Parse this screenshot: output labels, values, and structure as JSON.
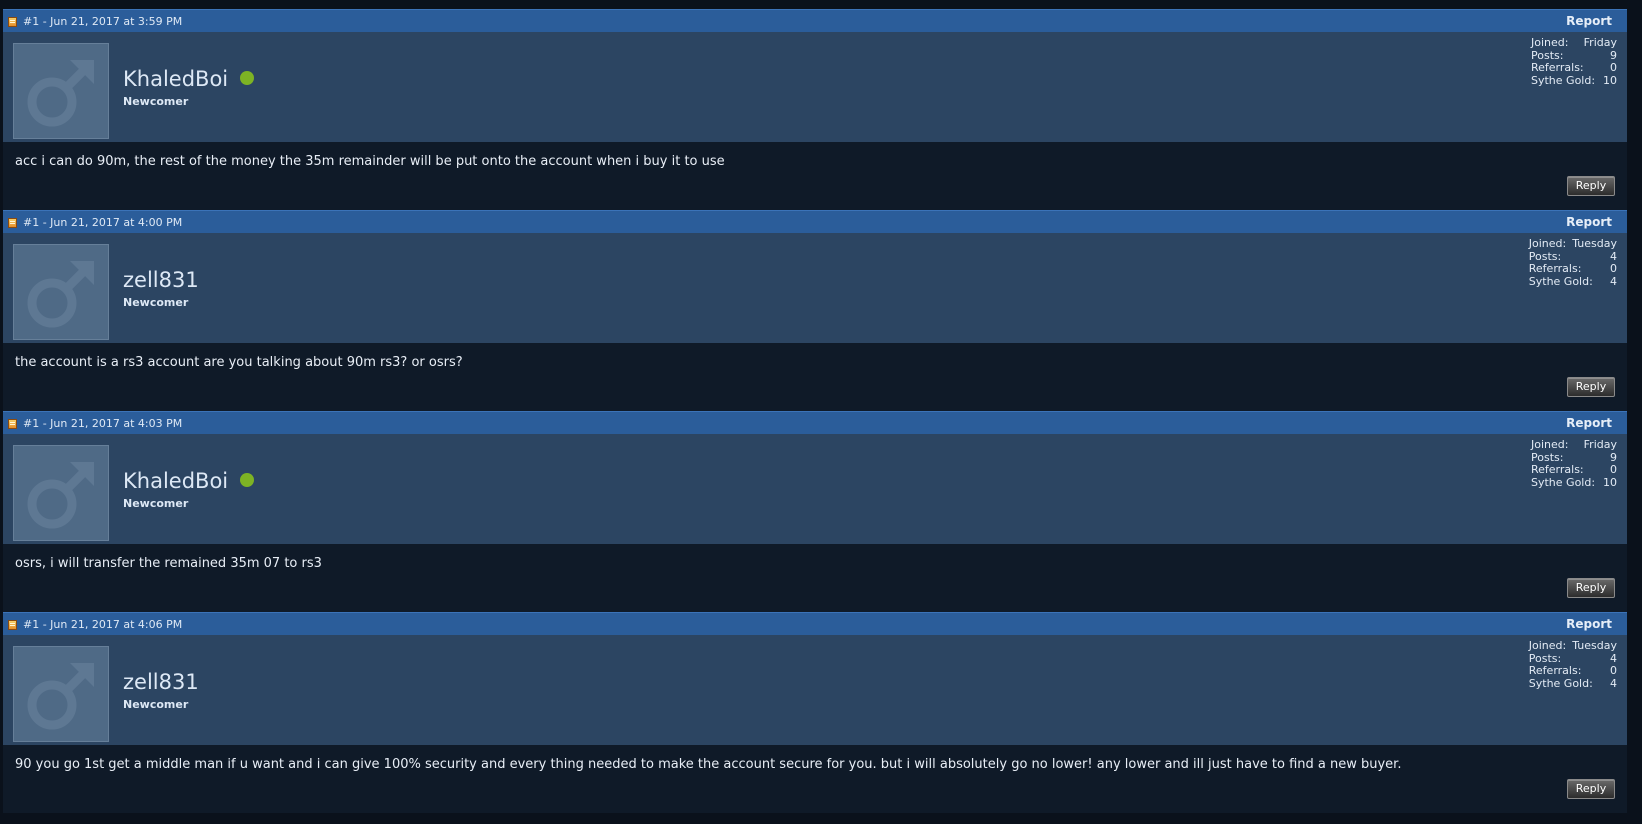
{
  "colors": {
    "header_bar": "#2b5d9a",
    "userinfo_bg": "#2c4562",
    "body_bg": "#0f1a28",
    "page_bg": "#0a111b",
    "online": "#7db324"
  },
  "labels": {
    "report": "Report",
    "reply": "Reply",
    "joined": "Joined:",
    "posts": "Posts:",
    "referrals": "Referrals:",
    "sythe_gold": "Sythe Gold:"
  },
  "posts": [
    {
      "date": "#1 - Jun 21, 2017 at 3:59 PM",
      "username": "KhaledBoi",
      "online": true,
      "usertitle": "Newcomer",
      "avatar_icon": "male-symbol-icon",
      "stats": {
        "joined": "Friday",
        "posts": "9",
        "referrals": "0",
        "sythe_gold": "10"
      },
      "message": "acc i can do 90m, the rest of the money the 35m remainder will be put onto the account when i buy it to use"
    },
    {
      "date": "#1 - Jun 21, 2017 at 4:00 PM",
      "username": "zell831",
      "online": false,
      "usertitle": "Newcomer",
      "avatar_icon": "male-symbol-icon",
      "stats": {
        "joined": "Tuesday",
        "posts": "4",
        "referrals": "0",
        "sythe_gold": "4"
      },
      "message": "the account is a rs3 account are you talking about 90m rs3? or osrs?"
    },
    {
      "date": "#1 - Jun 21, 2017 at 4:03 PM",
      "username": "KhaledBoi",
      "online": true,
      "usertitle": "Newcomer",
      "avatar_icon": "male-symbol-icon",
      "stats": {
        "joined": "Friday",
        "posts": "9",
        "referrals": "0",
        "sythe_gold": "10"
      },
      "message": "osrs, i will transfer the remained 35m 07 to rs3"
    },
    {
      "date": "#1 - Jun 21, 2017 at 4:06 PM",
      "username": "zell831",
      "online": false,
      "usertitle": "Newcomer",
      "avatar_icon": "male-symbol-icon",
      "stats": {
        "joined": "Tuesday",
        "posts": "4",
        "referrals": "0",
        "sythe_gold": "4"
      },
      "message": "90 you go 1st get a middle man if u want and i can give 100% security and every thing needed to make the account secure for you. but i will absolutely go no lower! any lower and ill just have to find a new buyer."
    }
  ]
}
